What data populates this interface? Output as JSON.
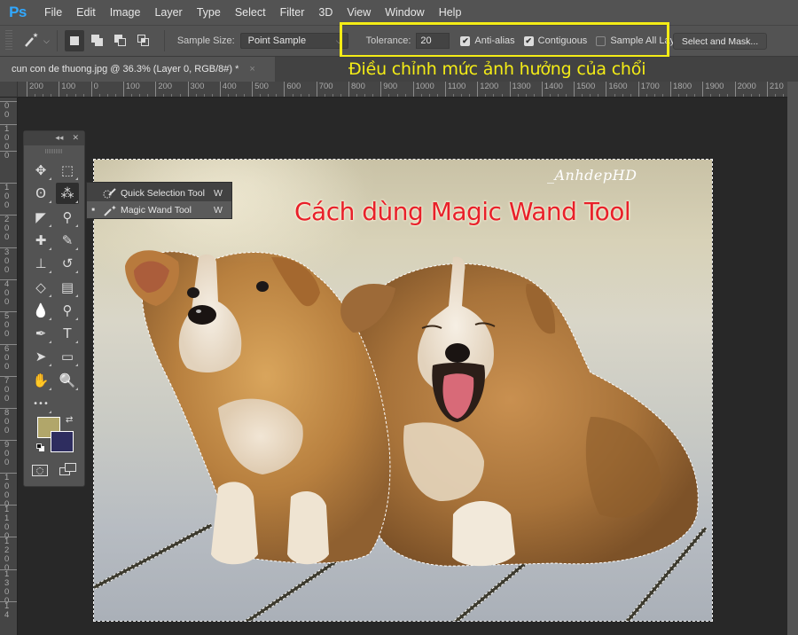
{
  "app": {
    "logo": "Ps",
    "menu": [
      "File",
      "Edit",
      "Image",
      "Layer",
      "Type",
      "Select",
      "Filter",
      "3D",
      "View",
      "Window",
      "Help"
    ]
  },
  "options_bar": {
    "tool_preset_icon": "magic-wand-icon",
    "selection_modes": [
      {
        "name": "new-selection",
        "active": true
      },
      {
        "name": "add-to-selection",
        "active": false
      },
      {
        "name": "subtract-from-selection",
        "active": false
      },
      {
        "name": "intersect-with-selection",
        "active": false
      }
    ],
    "sample_size_label": "Sample Size:",
    "sample_size_value": "Point Sample",
    "tolerance_label": "Tolerance:",
    "tolerance_value": "20",
    "anti_alias_label": "Anti-alias",
    "anti_alias_checked": true,
    "contiguous_label": "Contiguous",
    "contiguous_checked": true,
    "sample_all_layers_label": "Sample All Layers",
    "sample_all_layers_checked": false,
    "select_and_mask_label": "Select and Mask..."
  },
  "annotation": {
    "text": "Điều chỉnh mức ảnh hưởng của chổi",
    "color": "#f4ec16"
  },
  "document": {
    "tab_title": "cun con de thuong.jpg @ 36.3% (Layer 0, RGB/8#) *",
    "close_symbol": "×",
    "zoom": "36.3%"
  },
  "rulers": {
    "horizontal": [
      "200",
      "100",
      "0",
      "100",
      "200",
      "300",
      "400",
      "500",
      "600",
      "700",
      "800",
      "900",
      "1000",
      "1100",
      "1200",
      "1300",
      "1400",
      "1500",
      "1600",
      "1700",
      "1800",
      "1900",
      "2000",
      "210"
    ],
    "vertical": [
      "0\n0",
      "1\n0\n0",
      "0",
      "1\n0\n0",
      "2\n0\n0",
      "3\n0\n0",
      "4\n0\n0",
      "5\n0\n0",
      "6\n0\n0",
      "7\n0\n0",
      "8\n0\n0",
      "9\n0\n0",
      "1\n0\n0\n0",
      "1\n1\n0\n0",
      "1\n2\n0\n0",
      "1\n3\n0\n0",
      "1\n4"
    ]
  },
  "canvas": {
    "watermark": "_AnhdepHD",
    "title_overlay": "Cách dùng Magic Wand Tool",
    "title_color": "#e8202a"
  },
  "toolbox": {
    "header_collapse": "◂◂",
    "header_close": "✕",
    "tools": [
      {
        "name": "move-tool",
        "icon": "✥"
      },
      {
        "name": "rectangular-marquee-tool",
        "icon": "⬚"
      },
      {
        "name": "lasso-tool",
        "icon": "ʘ"
      },
      {
        "name": "magic-wand-tool",
        "icon": "⁂",
        "active": true
      },
      {
        "name": "crop-tool",
        "icon": "◤"
      },
      {
        "name": "eyedropper-tool",
        "icon": "⚲"
      },
      {
        "name": "healing-brush-tool",
        "icon": "✚"
      },
      {
        "name": "brush-tool",
        "icon": "✎"
      },
      {
        "name": "clone-stamp-tool",
        "icon": "⊥"
      },
      {
        "name": "history-brush-tool",
        "icon": "↺"
      },
      {
        "name": "eraser-tool",
        "icon": "◇"
      },
      {
        "name": "gradient-tool",
        "icon": "▤"
      },
      {
        "name": "blur-tool",
        "icon": "💧"
      },
      {
        "name": "dodge-tool",
        "icon": "⚲"
      },
      {
        "name": "pen-tool",
        "icon": "✒"
      },
      {
        "name": "type-tool",
        "icon": "T"
      },
      {
        "name": "path-selection-tool",
        "icon": "➤"
      },
      {
        "name": "rectangle-tool",
        "icon": "▭"
      },
      {
        "name": "hand-tool",
        "icon": "✋"
      },
      {
        "name": "zoom-tool",
        "icon": "🔍"
      },
      {
        "name": "edit-toolbar",
        "icon": "•••"
      }
    ],
    "foreground_color": "#b1a66a",
    "background_color": "#2e2d5f",
    "quick_mask_icon": "quick-mask-icon",
    "screen_mode_icon": "screen-mode-icon"
  },
  "flyout": {
    "items": [
      {
        "label": "Quick Selection Tool",
        "shortcut": "W",
        "selected": false
      },
      {
        "label": "Magic Wand Tool",
        "shortcut": "W",
        "selected": true
      }
    ]
  }
}
